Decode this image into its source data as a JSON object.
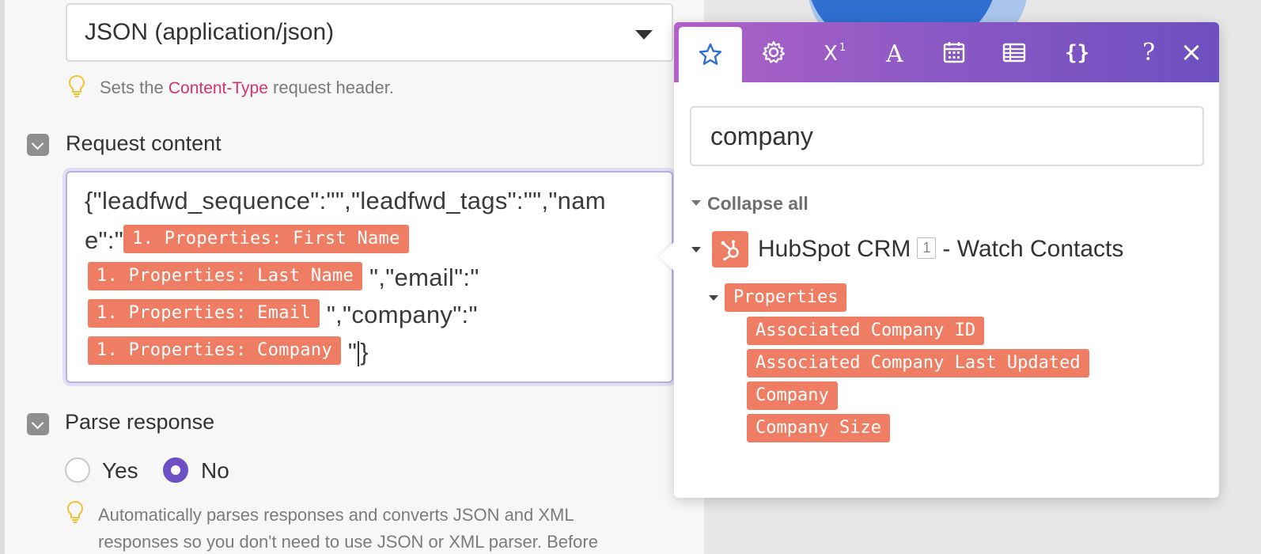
{
  "content_type": {
    "selected": "JSON (application/json)",
    "hint_prefix": "Sets the",
    "hint_code": "Content-Type",
    "hint_suffix": "request header."
  },
  "request_content": {
    "label": "Request content",
    "line1": "{\"leadfwd_sequence\":\"\",\"leadfwd_tags\":\"\",\"nam",
    "line2_text": "e\":\"",
    "pill_first_name": "1. Properties: First Name",
    "pill_last_name": "1. Properties: Last Name",
    "after_last_name": "\",\"email\":\"",
    "pill_email": "1. Properties: Email",
    "after_email": "\",\"company\":\"",
    "pill_company": "1. Properties: Company",
    "after_company_quote": "\"",
    "after_cursor": "}"
  },
  "parse_response": {
    "label": "Parse response",
    "option_yes": "Yes",
    "option_no": "No",
    "selected": "No",
    "hint_line1": "Automatically parses responses and converts JSON and XML",
    "hint_line2": "responses so you don't need to use JSON or XML parser. Before"
  },
  "popup": {
    "tabs": [
      {
        "icon": "star-icon",
        "active": true
      },
      {
        "icon": "gear-icon",
        "active": false
      },
      {
        "icon": "superscript-icon",
        "active": false
      },
      {
        "icon": "text-icon",
        "active": false
      },
      {
        "icon": "calendar-icon",
        "active": false
      },
      {
        "icon": "table-icon",
        "active": false
      },
      {
        "icon": "braces-icon",
        "active": false
      }
    ],
    "help_glyph": "?",
    "close_glyph": "×",
    "search_value": "company",
    "collapse_all": "Collapse all",
    "module": {
      "name": "HubSpot CRM",
      "number": "1",
      "suffix": "- Watch Contacts"
    },
    "group_label": "Properties",
    "items": [
      "Associated Company ID",
      "Associated Company Last Updated",
      "Company",
      "Company Size"
    ]
  },
  "colors": {
    "accent_purple": "#6e4fc4",
    "pill_orange": "#ee7d63",
    "header_gradient_start": "#b062c8",
    "header_gradient_end": "#6e4fc0",
    "code_pink": "#d6336c",
    "bulb_yellow": "#f2c230"
  }
}
